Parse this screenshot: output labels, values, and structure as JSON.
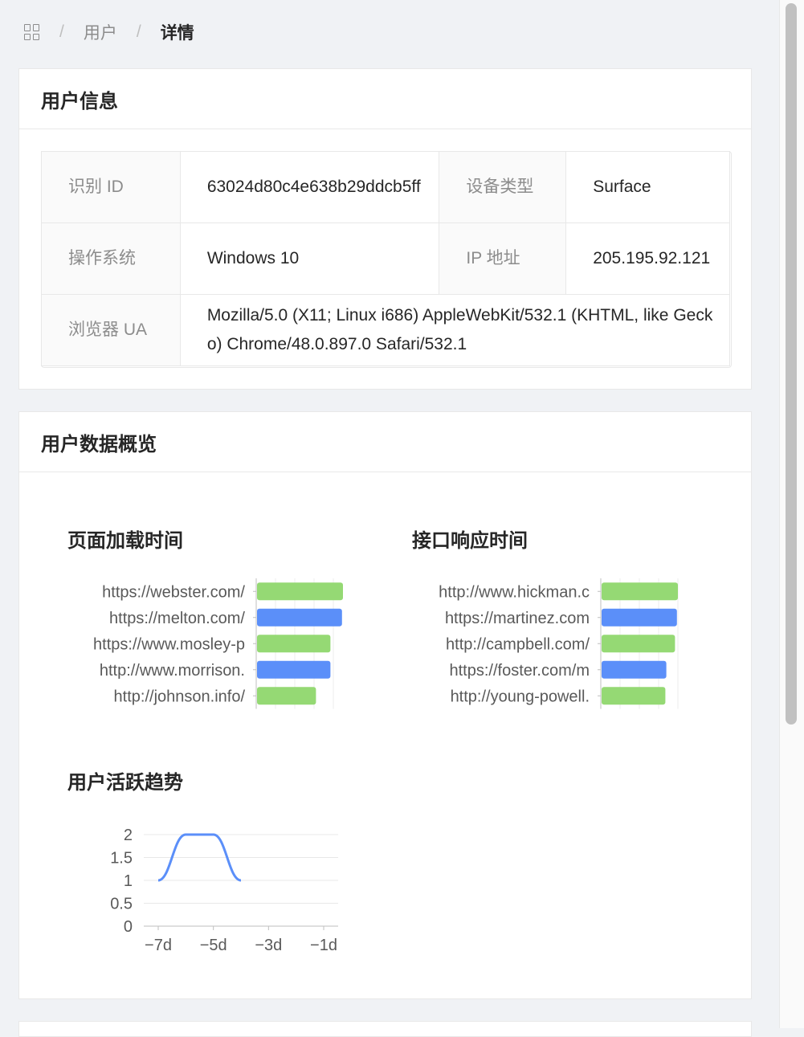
{
  "breadcrumb": {
    "home_icon": "app-grid-icon",
    "items": [
      "用户",
      "详情"
    ],
    "separator": "/"
  },
  "user_info": {
    "title": "用户信息",
    "rows": [
      {
        "label1": "识别 ID",
        "value1": "63024d80c4e638b29ddcb5ff",
        "label2": "设备类型",
        "value2": "Surface"
      },
      {
        "label1": "操作系统",
        "value1": "Windows 10",
        "label2": "IP 地址",
        "value2": "205.195.92.121"
      },
      {
        "label1": "浏览器 UA",
        "value1": "Mozilla/5.0 (X11; Linux i686) AppleWebKit/532.1 (KHTML, like Gecko) Chrome/48.0.897.0 Safari/532.1"
      }
    ]
  },
  "overview": {
    "title": "用户数据概览"
  },
  "chart_data": [
    {
      "type": "bar",
      "title": "页面加载时间",
      "categories": [
        "https://webster.com/",
        "https://melton.com/",
        "https://www.mosley-p",
        "http://www.morrison.",
        "http://johnson.info/"
      ],
      "values": [
        45,
        44.5,
        38.5,
        38.5,
        31
      ],
      "colors": [
        "#95d974",
        "#5b8ff9",
        "#95d974",
        "#5b8ff9",
        "#95d974"
      ],
      "xlim": [
        0,
        50
      ],
      "grid": true
    },
    {
      "type": "bar",
      "title": "接口响应时间",
      "categories": [
        "http://www.hickman.c",
        "https://martinez.com",
        "http://campbell.com/",
        "https://foster.com/m",
        "http://young-powell."
      ],
      "values": [
        40,
        39.5,
        38.5,
        34,
        33.5
      ],
      "colors": [
        "#95d974",
        "#5b8ff9",
        "#95d974",
        "#5b8ff9",
        "#95d974"
      ],
      "xlim": [
        0,
        50
      ],
      "grid": true
    },
    {
      "type": "line",
      "title": "用户活跃趋势",
      "x": [
        "-7d",
        "-6d",
        "-5d",
        "-4d",
        "-3d",
        "-2d",
        "-1d"
      ],
      "x_ticks": [
        "−7d",
        "−5d",
        "−3d",
        "−1d"
      ],
      "series": [
        {
          "values": [
            1,
            2,
            2,
            1,
            null,
            null,
            null
          ]
        }
      ],
      "y_ticks": [
        "0",
        "0.5",
        "1",
        "1.5",
        "2"
      ],
      "ylim": [
        0,
        2
      ],
      "grid": true,
      "color": "#5b8ff9"
    }
  ]
}
